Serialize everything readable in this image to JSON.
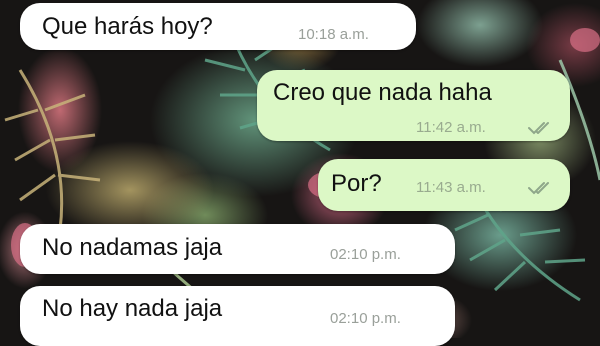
{
  "chat": {
    "messages": [
      {
        "direction": "incoming",
        "text": "Que harás hoy?",
        "time": "10:18 a.m."
      },
      {
        "direction": "outgoing",
        "text": "Creo que nada haha",
        "time": "11:42 a.m.",
        "status": "read"
      },
      {
        "direction": "outgoing",
        "text": "Por?",
        "time": "11:43 a.m.",
        "status": "read"
      },
      {
        "direction": "incoming",
        "text": "No nadamas jaja",
        "time": "02:10 p.m."
      },
      {
        "direction": "incoming",
        "text": "No hay nada jaja",
        "time": "02:10 p.m."
      }
    ]
  },
  "colors": {
    "incoming_bubble": "#ffffff",
    "outgoing_bubble": "#dcf8c6",
    "read_ticks": "#8fa78a"
  },
  "icons": {
    "read_status": "double-check-icon"
  }
}
